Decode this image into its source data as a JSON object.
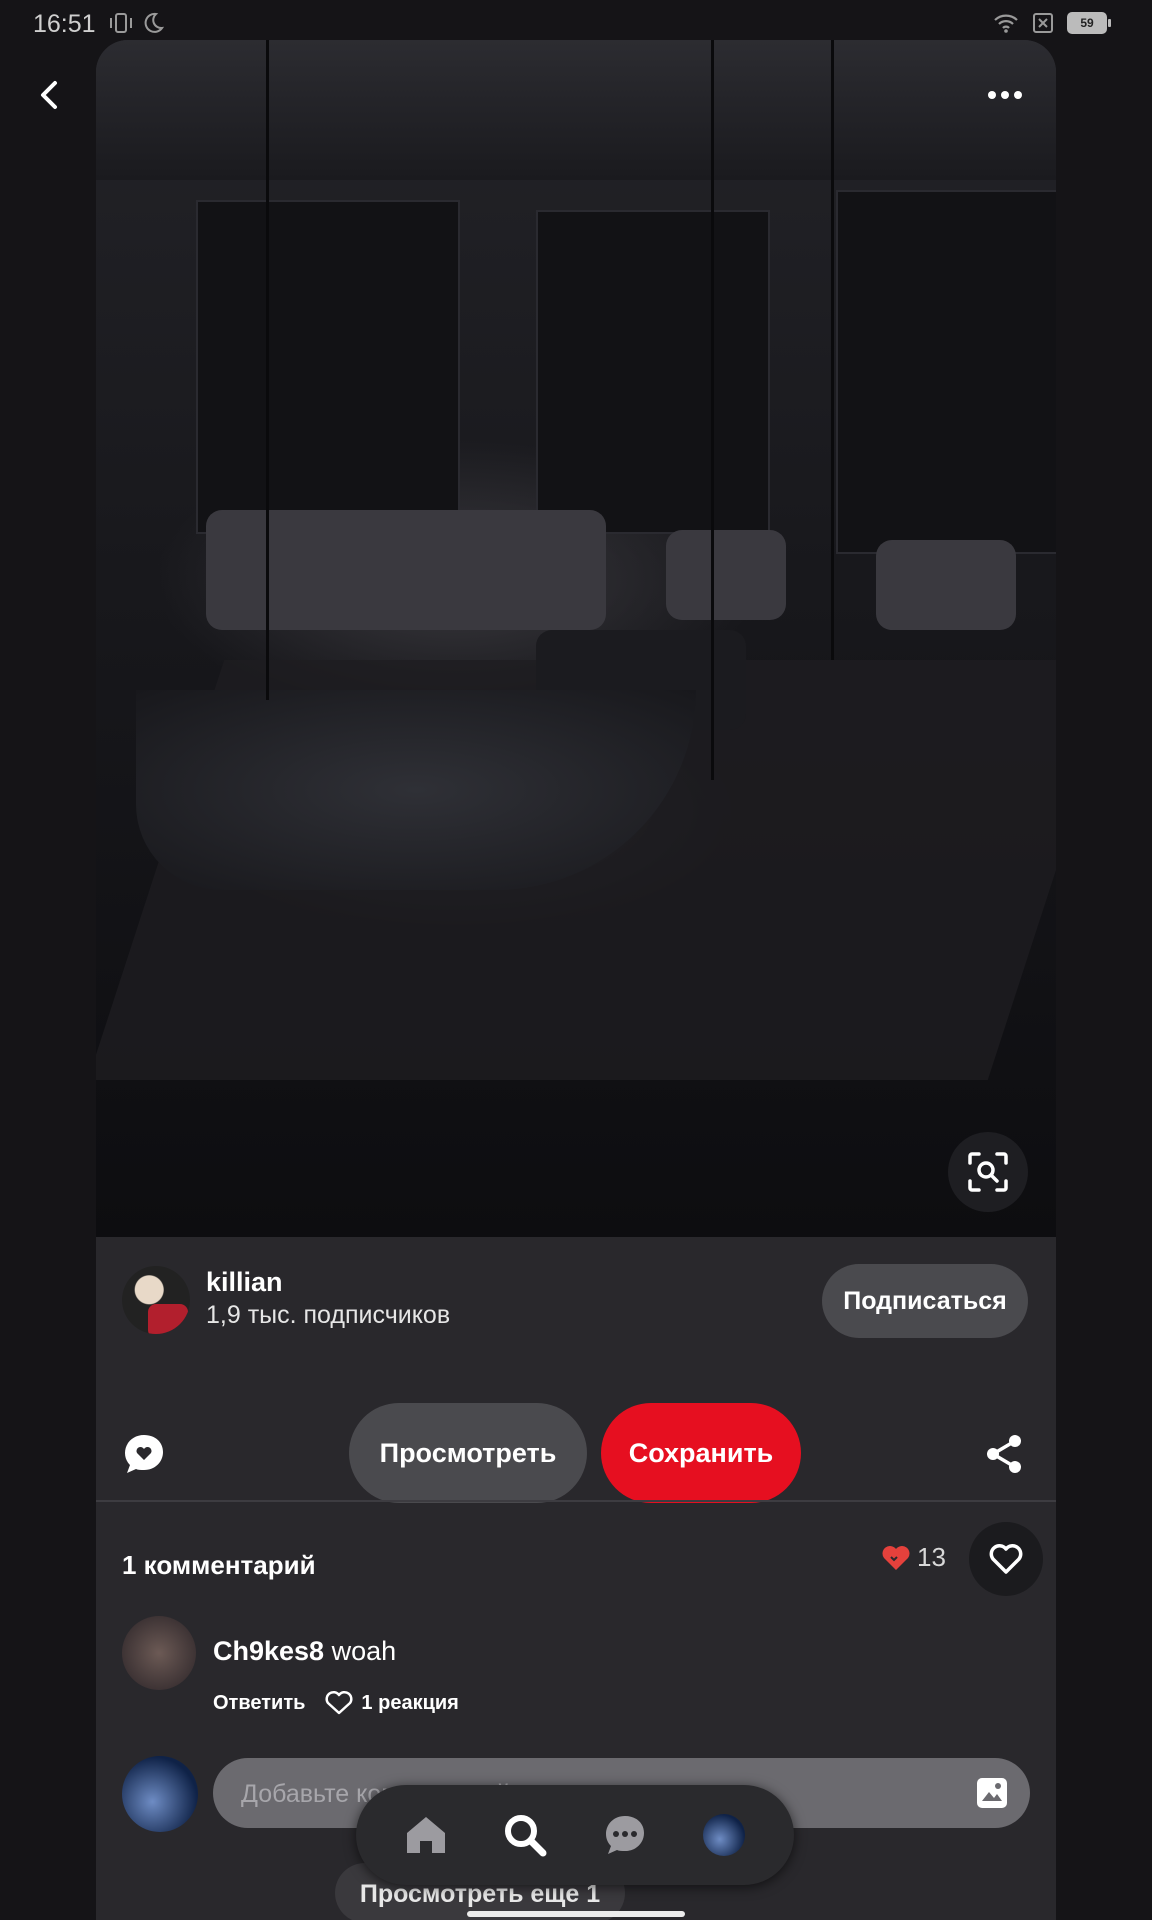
{
  "status_bar": {
    "time": "16:51",
    "battery": "59"
  },
  "pin": {
    "author": {
      "name": "killian",
      "followers": "1,9 тыс. подписчиков"
    },
    "follow_label": "Подписаться",
    "view_label": "Просмотреть",
    "save_label": "Сохранить"
  },
  "comments": {
    "header": "1 комментарий",
    "reaction_count": "13",
    "items": [
      {
        "author": "Ch9kes8",
        "text": "woah",
        "reply_label": "Ответить",
        "reactions_label": "1 реакция"
      }
    ],
    "input_placeholder": "Добавьте комментарий",
    "more_label": "Просмотреть еще 1"
  },
  "icons": {
    "back": "back-icon",
    "more": "more-icon",
    "lens": "visual-search-icon",
    "comment": "comment-icon",
    "share": "share-icon",
    "heart": "heart-icon",
    "image": "image-icon",
    "home": "home-icon",
    "search": "search-icon",
    "messages": "messages-icon"
  },
  "colors": {
    "save": "#e60f20",
    "heart": "#e5413c",
    "card_bg": "#29282c"
  }
}
